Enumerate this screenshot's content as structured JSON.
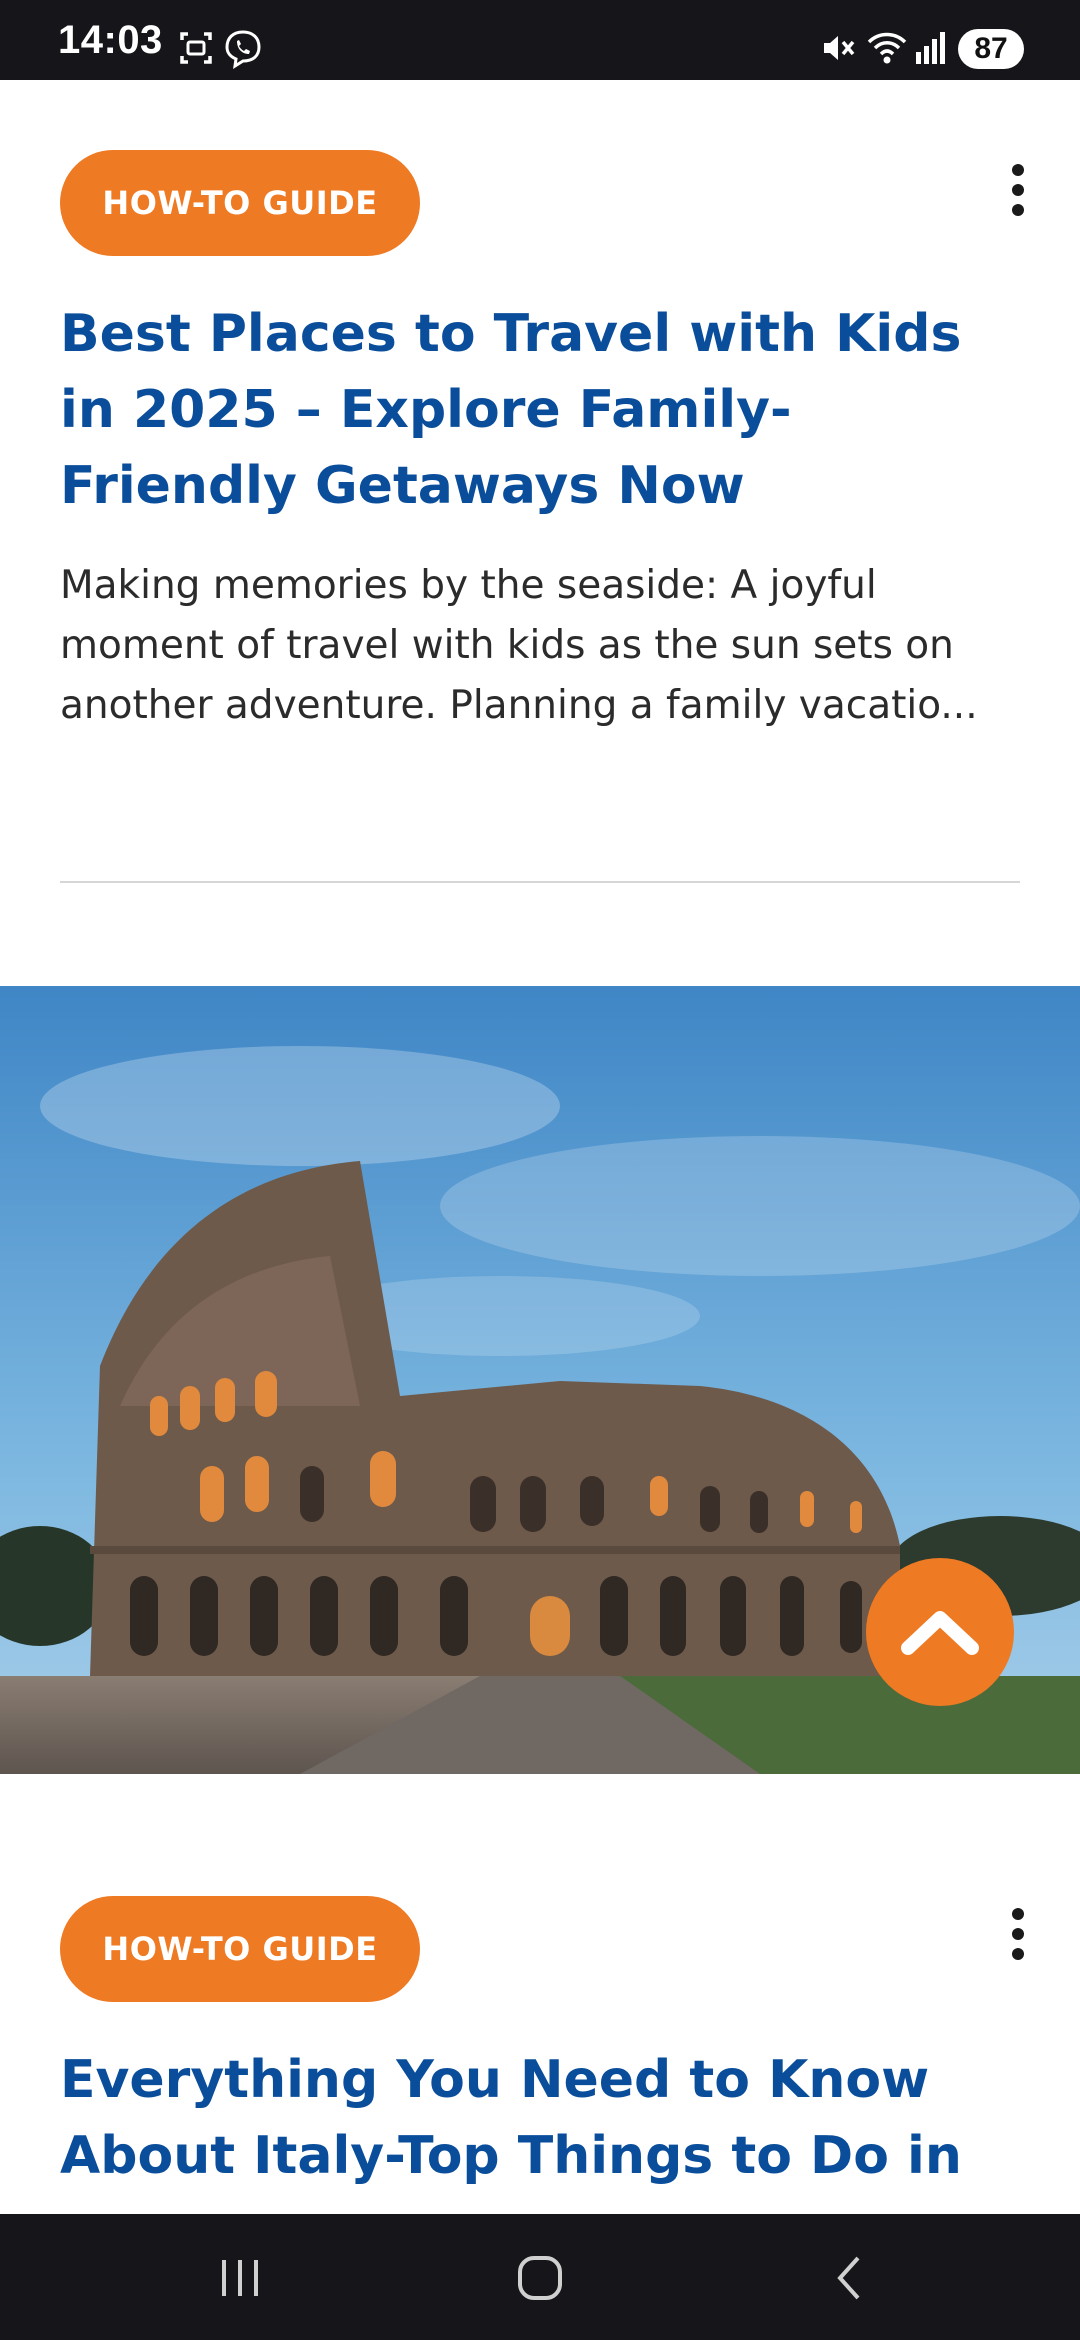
{
  "status_bar": {
    "time": "14:03",
    "battery": "87",
    "icons": [
      "screenshot-icon",
      "viber-icon",
      "mute-icon",
      "wifi-icon",
      "signal-icon",
      "battery-icon"
    ]
  },
  "articles": [
    {
      "badge": "HOW-TO GUIDE",
      "title_lines": [
        "Best Places to Travel with Kids",
        "in 2025 – Explore Family-",
        "Friendly Getaways Now"
      ],
      "excerpt_lines": [
        "Making memories by the seaside: A joyful",
        "moment of travel with kids as the sun sets on",
        "another adventure. Planning a family vacatio..."
      ]
    },
    {
      "badge": "HOW-TO GUIDE",
      "title_lines": [
        "Everything You Need to Know",
        "About Italy-Top Things to Do in"
      ]
    }
  ],
  "hero_image": {
    "subject": "colosseum-photo"
  },
  "fab": {
    "icon": "chevron-up-icon"
  },
  "nav_bar": {
    "icons": [
      "recent-apps-icon",
      "home-icon",
      "back-icon"
    ]
  },
  "colors": {
    "accent": "#ee7a23",
    "title": "#0a4e9b",
    "text": "#2b2b2b",
    "system_bar": "#16161a"
  }
}
